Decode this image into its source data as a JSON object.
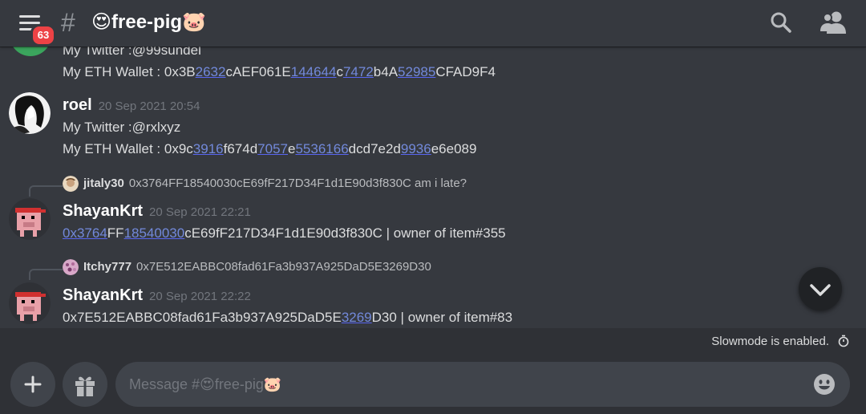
{
  "header": {
    "badge_count": "63",
    "channel_name": "😍free-pig🐷"
  },
  "messages": {
    "msg1": {
      "line1": "My Twitter :@99sundel",
      "wallet_prefix": "My ETH Wallet : 0x3B",
      "wallet_parts": [
        "2632",
        "cAEF061E",
        "144644",
        "c",
        "7472",
        "b4A",
        "52985",
        "CFAD9F4"
      ]
    },
    "msg2": {
      "username": "roel",
      "timestamp": "20 Sep 2021 20:54",
      "line1": "My Twitter :@rxlxyz",
      "wallet_prefix": "My ETH Wallet : 0x9c",
      "wallet_parts": [
        "3916",
        "f674d",
        "7057",
        "e",
        "5536166",
        "dcd7e2d",
        "9936",
        "e6e089"
      ]
    },
    "msg3": {
      "reply_user": "jitaly30",
      "reply_text": "0x3764FF18540030cE69fF217D34F1d1E90d3f830C am i late?",
      "username": "ShayanKrt",
      "timestamp": "20 Sep 2021 22:21",
      "parts": [
        "0x3764",
        "FF",
        "18540030",
        "cE69fF217D34F1d1E90d3f830C | owner of item#355"
      ]
    },
    "msg4": {
      "reply_user": "Itchy777",
      "reply_text": "0x7E512EABBC08fad61Fa3b937A925DaD5E3269D30",
      "username": "ShayanKrt",
      "timestamp": "20 Sep 2021 22:22",
      "parts": [
        "0x7E512EABBC08fad61Fa3b937A925DaD5E",
        "3269",
        "D30 | owner of item#83"
      ]
    }
  },
  "slowmode": {
    "text": "Slowmode is enabled."
  },
  "composer": {
    "placeholder": "Message #😍free-pig🐷"
  },
  "colors": {
    "background": "#36393f",
    "secondary": "#2f3136",
    "input": "#40444b",
    "link": "#7289da",
    "badge": "#ed4245"
  }
}
